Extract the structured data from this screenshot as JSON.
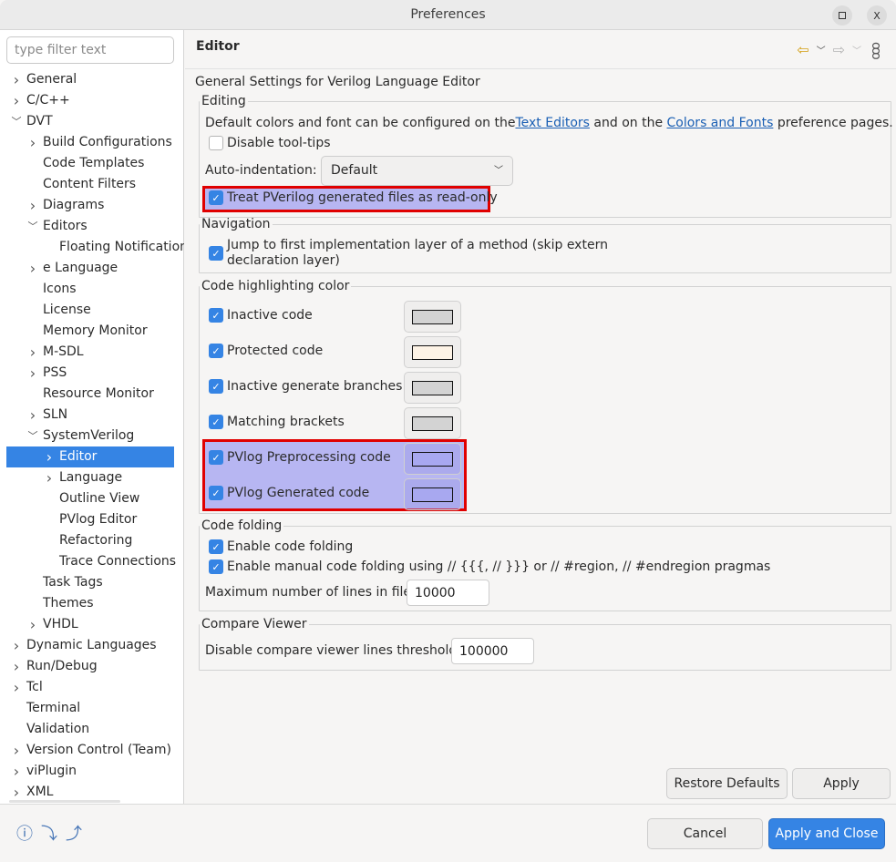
{
  "window": {
    "title": "Preferences",
    "maximize_icon": "maximize-icon",
    "close_icon": "close-icon",
    "close_glyph": "X"
  },
  "sidebar": {
    "filter_placeholder": "type filter text",
    "items": [
      {
        "label": "General",
        "level": 0,
        "twisty": "collapsed"
      },
      {
        "label": "C/C++",
        "level": 0,
        "twisty": "collapsed"
      },
      {
        "label": "DVT",
        "level": 0,
        "twisty": "expanded"
      },
      {
        "label": "Build Configurations",
        "level": 1,
        "twisty": "collapsed"
      },
      {
        "label": "Code Templates",
        "level": 1,
        "twisty": "none"
      },
      {
        "label": "Content Filters",
        "level": 1,
        "twisty": "none"
      },
      {
        "label": "Diagrams",
        "level": 1,
        "twisty": "collapsed"
      },
      {
        "label": "Editors",
        "level": 1,
        "twisty": "expanded"
      },
      {
        "label": "Floating Notifications",
        "level": 2,
        "twisty": "none"
      },
      {
        "label": "e Language",
        "level": 1,
        "twisty": "collapsed"
      },
      {
        "label": "Icons",
        "level": 1,
        "twisty": "none"
      },
      {
        "label": "License",
        "level": 1,
        "twisty": "none"
      },
      {
        "label": "Memory Monitor",
        "level": 1,
        "twisty": "none"
      },
      {
        "label": "M-SDL",
        "level": 1,
        "twisty": "collapsed"
      },
      {
        "label": "PSS",
        "level": 1,
        "twisty": "collapsed"
      },
      {
        "label": "Resource Monitor",
        "level": 1,
        "twisty": "none"
      },
      {
        "label": "SLN",
        "level": 1,
        "twisty": "collapsed"
      },
      {
        "label": "SystemVerilog",
        "level": 1,
        "twisty": "expanded"
      },
      {
        "label": "Editor",
        "level": 2,
        "twisty": "collapsed",
        "selected": true
      },
      {
        "label": "Language",
        "level": 2,
        "twisty": "collapsed"
      },
      {
        "label": "Outline View",
        "level": 2,
        "twisty": "none"
      },
      {
        "label": "PVlog Editor",
        "level": 2,
        "twisty": "none"
      },
      {
        "label": "Refactoring",
        "level": 2,
        "twisty": "none"
      },
      {
        "label": "Trace Connections",
        "level": 2,
        "twisty": "none"
      },
      {
        "label": "Task Tags",
        "level": 1,
        "twisty": "none"
      },
      {
        "label": "Themes",
        "level": 1,
        "twisty": "none"
      },
      {
        "label": "VHDL",
        "level": 1,
        "twisty": "collapsed"
      },
      {
        "label": "Dynamic Languages",
        "level": 0,
        "twisty": "collapsed"
      },
      {
        "label": "Run/Debug",
        "level": 0,
        "twisty": "collapsed"
      },
      {
        "label": "Tcl",
        "level": 0,
        "twisty": "collapsed"
      },
      {
        "label": "Terminal",
        "level": 0,
        "twisty": "none"
      },
      {
        "label": "Validation",
        "level": 0,
        "twisty": "none"
      },
      {
        "label": "Version Control (Team)",
        "level": 0,
        "twisty": "collapsed"
      },
      {
        "label": "viPlugin",
        "level": 0,
        "twisty": "collapsed"
      },
      {
        "label": "XML",
        "level": 0,
        "twisty": "collapsed"
      }
    ]
  },
  "page": {
    "title": "Editor",
    "description": "General Settings for Verilog Language Editor",
    "toolbar": {
      "back_icon": "back-arrow-icon",
      "forward_icon": "forward-arrow-icon",
      "menu_icon": "view-menu-icon"
    },
    "editing": {
      "legend": "Editing",
      "info_prefix": "Default colors and font can be configured on the ",
      "link1": "Text Editors",
      "info_mid": " and on the ",
      "link2": "Colors and Fonts",
      "info_suffix": " preference pages.",
      "disable_tooltips": {
        "label": "Disable tool-tips",
        "checked": false
      },
      "auto_indent_label": "Auto-indentation:",
      "auto_indent_value": "Default",
      "treat_readonly": {
        "label": "Treat PVerilog generated files as read-only",
        "checked": true
      }
    },
    "navigation": {
      "legend": "Navigation",
      "jump": {
        "label_line1": "Jump to first implementation layer of a method (skip extern",
        "label_line2": "declaration layer)",
        "checked": true
      }
    },
    "highlighting": {
      "legend": "Code highlighting color",
      "items": [
        {
          "label": "Inactive code",
          "checked": true,
          "color": "#d3d3d3"
        },
        {
          "label": "Protected code",
          "checked": true,
          "color": "#fdf3e6"
        },
        {
          "label": "Inactive generate branches",
          "checked": true,
          "color": "#d3d3d3"
        },
        {
          "label": "Matching brackets",
          "checked": true,
          "color": "#d3d3d3"
        },
        {
          "label": "PVlog Preprocessing code",
          "checked": true,
          "color": "#a8a8f0"
        },
        {
          "label": "PVlog Generated code",
          "checked": true,
          "color": "#a8a8f0"
        }
      ]
    },
    "folding": {
      "legend": "Code folding",
      "enable": {
        "label": "Enable code folding",
        "checked": true
      },
      "manual": {
        "label": "Enable manual code folding using // {{{, // }}} or // #region, // #endregion pragmas",
        "checked": true
      },
      "max_lines_label": "Maximum number of lines in file",
      "max_lines_value": "10000"
    },
    "compare": {
      "legend": "Compare Viewer",
      "threshold_label": "Disable compare viewer lines threshold",
      "threshold_value": "100000"
    },
    "restore_defaults_label": "Restore Defaults",
    "apply_label": "Apply"
  },
  "footer": {
    "help_icon": "help-icon",
    "import_icon": "import-icon",
    "export_icon": "export-icon",
    "cancel_label": "Cancel",
    "apply_close_label": "Apply and Close"
  },
  "colors": {
    "accent": "#3584e4",
    "highlight_border": "#e00000",
    "link": "#1a5fb4"
  }
}
